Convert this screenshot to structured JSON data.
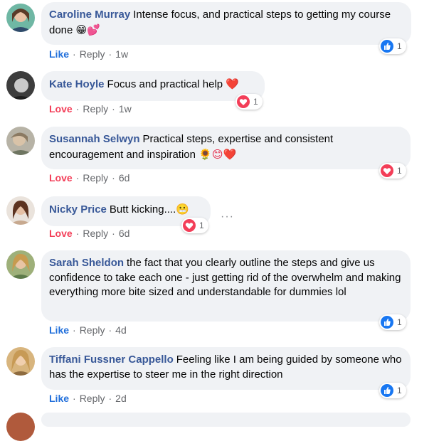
{
  "comments": [
    {
      "name": "Caroline Murray",
      "text": "Intense focus, and practical steps to getting my course done",
      "emoji": "😁💕",
      "reaction_label": "Like",
      "reply": "Reply",
      "time": "1w",
      "reaction_count": "1",
      "reaction_type": "like"
    },
    {
      "name": "Kate Hoyle",
      "text": "Focus and practical help",
      "emoji": "❤️",
      "reaction_label": "Love",
      "reply": "Reply",
      "time": "1w",
      "reaction_count": "1",
      "reaction_type": "love"
    },
    {
      "name": "Susannah Selwyn",
      "text": "Practical steps, expertise and consistent encouragement and inspiration",
      "emoji": "🌻😊❤️",
      "reaction_label": "Love",
      "reply": "Reply",
      "time": "6d",
      "reaction_count": "1",
      "reaction_type": "love"
    },
    {
      "name": "Nicky Price",
      "text": "Butt kicking....",
      "emoji": "😬",
      "reaction_label": "Love",
      "reply": "Reply",
      "time": "6d",
      "reaction_count": "1",
      "reaction_type": "love"
    },
    {
      "name": "Sarah Sheldon",
      "text": "the fact that you clearly outline the steps and give us confidence to take each one - just getting rid of the overwhelm and making everything more bite sized and understandable for dummies lol",
      "emoji": "",
      "reaction_label": "Like",
      "reply": "Reply",
      "time": "4d",
      "reaction_count": "1",
      "reaction_type": "like"
    },
    {
      "name": "Tiffani Fussner Cappello",
      "text": "Feeling like I am being guided by someone who has the expertise to steer me in the right direction",
      "emoji": "",
      "reaction_label": "Like",
      "reply": "Reply",
      "time": "2d",
      "reaction_count": "1",
      "reaction_type": "like"
    }
  ],
  "more_options": "···",
  "colors": {
    "name": "#385898",
    "like": "#216fdb",
    "love": "#f33e58",
    "bubble": "#f0f2f5"
  }
}
